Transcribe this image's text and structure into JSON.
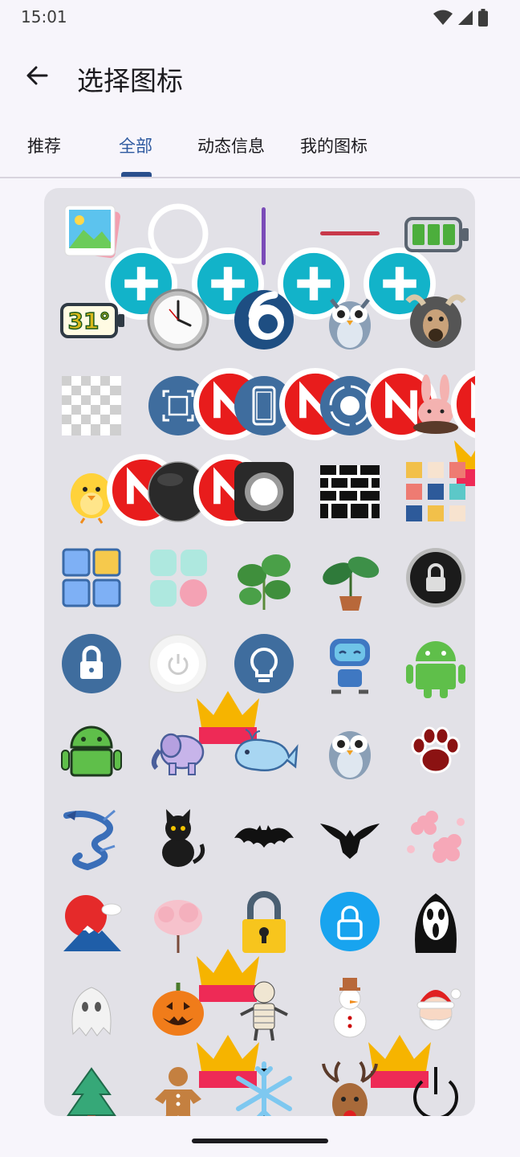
{
  "status_bar": {
    "time": "15:01"
  },
  "app_bar": {
    "title": "选择图标"
  },
  "tabs": [
    {
      "label": "推荐",
      "active": false
    },
    {
      "label": "全部",
      "active": true
    },
    {
      "label": "动态信息",
      "active": false
    },
    {
      "label": "我的图标",
      "active": false
    }
  ],
  "colors": {
    "accent": "#2e5aa0",
    "tile_blue": "#3f6d9e",
    "badge_red": "#e81c1c",
    "add_teal": "#12b3c9"
  },
  "icons": [
    {
      "name": "photo-gallery-icon",
      "badge": "add"
    },
    {
      "name": "ring-outline-icon",
      "badge": "add"
    },
    {
      "name": "vertical-line-icon",
      "badge": "add"
    },
    {
      "name": "horizontal-line-icon",
      "badge": "add"
    },
    {
      "name": "battery-icon",
      "badge": ""
    },
    {
      "name": "calendar-31-battery-icon",
      "badge": ""
    },
    {
      "name": "analog-clock-icon",
      "badge": ""
    },
    {
      "name": "number-6-icon",
      "badge": ""
    },
    {
      "name": "owl-icon",
      "badge": ""
    },
    {
      "name": "moose-icon",
      "badge": ""
    },
    {
      "name": "transparent-icon",
      "badge": ""
    },
    {
      "name": "screenshot-scan-icon",
      "badge": "new"
    },
    {
      "name": "phone-frame-icon",
      "badge": "new"
    },
    {
      "name": "record-button-icon",
      "badge": "new"
    },
    {
      "name": "bunny-icon",
      "badge": "new_crown"
    },
    {
      "name": "chick-icon",
      "badge": "new"
    },
    {
      "name": "black-ball-icon",
      "badge": "new"
    },
    {
      "name": "assistive-touch-icon",
      "badge": ""
    },
    {
      "name": "brick-wall-icon",
      "badge": ""
    },
    {
      "name": "color-palette-icon",
      "badge": ""
    },
    {
      "name": "blue-grid-icon",
      "badge": ""
    },
    {
      "name": "mint-grid-icon",
      "badge": ""
    },
    {
      "name": "monstera-plant-icon",
      "badge": ""
    },
    {
      "name": "potted-plant-icon",
      "badge": ""
    },
    {
      "name": "dark-lock-icon",
      "badge": ""
    },
    {
      "name": "lock-icon",
      "badge": ""
    },
    {
      "name": "power-button-icon",
      "badge": "crown"
    },
    {
      "name": "light-bulb-icon",
      "badge": ""
    },
    {
      "name": "robot-icon",
      "badge": ""
    },
    {
      "name": "android-icon",
      "badge": ""
    },
    {
      "name": "android-outline-icon",
      "badge": ""
    },
    {
      "name": "elephant-icon",
      "badge": ""
    },
    {
      "name": "whale-icon",
      "badge": ""
    },
    {
      "name": "owl-icon-2",
      "badge": ""
    },
    {
      "name": "paw-icon",
      "badge": ""
    },
    {
      "name": "dragon-icon",
      "badge": ""
    },
    {
      "name": "black-cat-icon",
      "badge": ""
    },
    {
      "name": "bat-icon",
      "badge": ""
    },
    {
      "name": "eagle-icon",
      "badge": ""
    },
    {
      "name": "sakura-icon",
      "badge": ""
    },
    {
      "name": "mount-fuji-icon",
      "badge": ""
    },
    {
      "name": "cherry-tree-icon",
      "badge": "crown"
    },
    {
      "name": "padlock-icon",
      "badge": ""
    },
    {
      "name": "lock-circle-icon",
      "badge": ""
    },
    {
      "name": "scream-mask-icon",
      "badge": ""
    },
    {
      "name": "ghost-icon",
      "badge": ""
    },
    {
      "name": "pumpkin-icon",
      "badge": "crown"
    },
    {
      "name": "mummy-icon",
      "badge": ""
    },
    {
      "name": "snowman-icon",
      "badge": "crown"
    },
    {
      "name": "santa-icon",
      "badge": ""
    },
    {
      "name": "christmas-tree-icon",
      "badge": ""
    },
    {
      "name": "gingerbread-icon",
      "badge": "crown"
    },
    {
      "name": "snowflake-icon",
      "badge": ""
    },
    {
      "name": "reindeer-icon",
      "badge": ""
    },
    {
      "name": "power-icon",
      "badge": ""
    }
  ]
}
